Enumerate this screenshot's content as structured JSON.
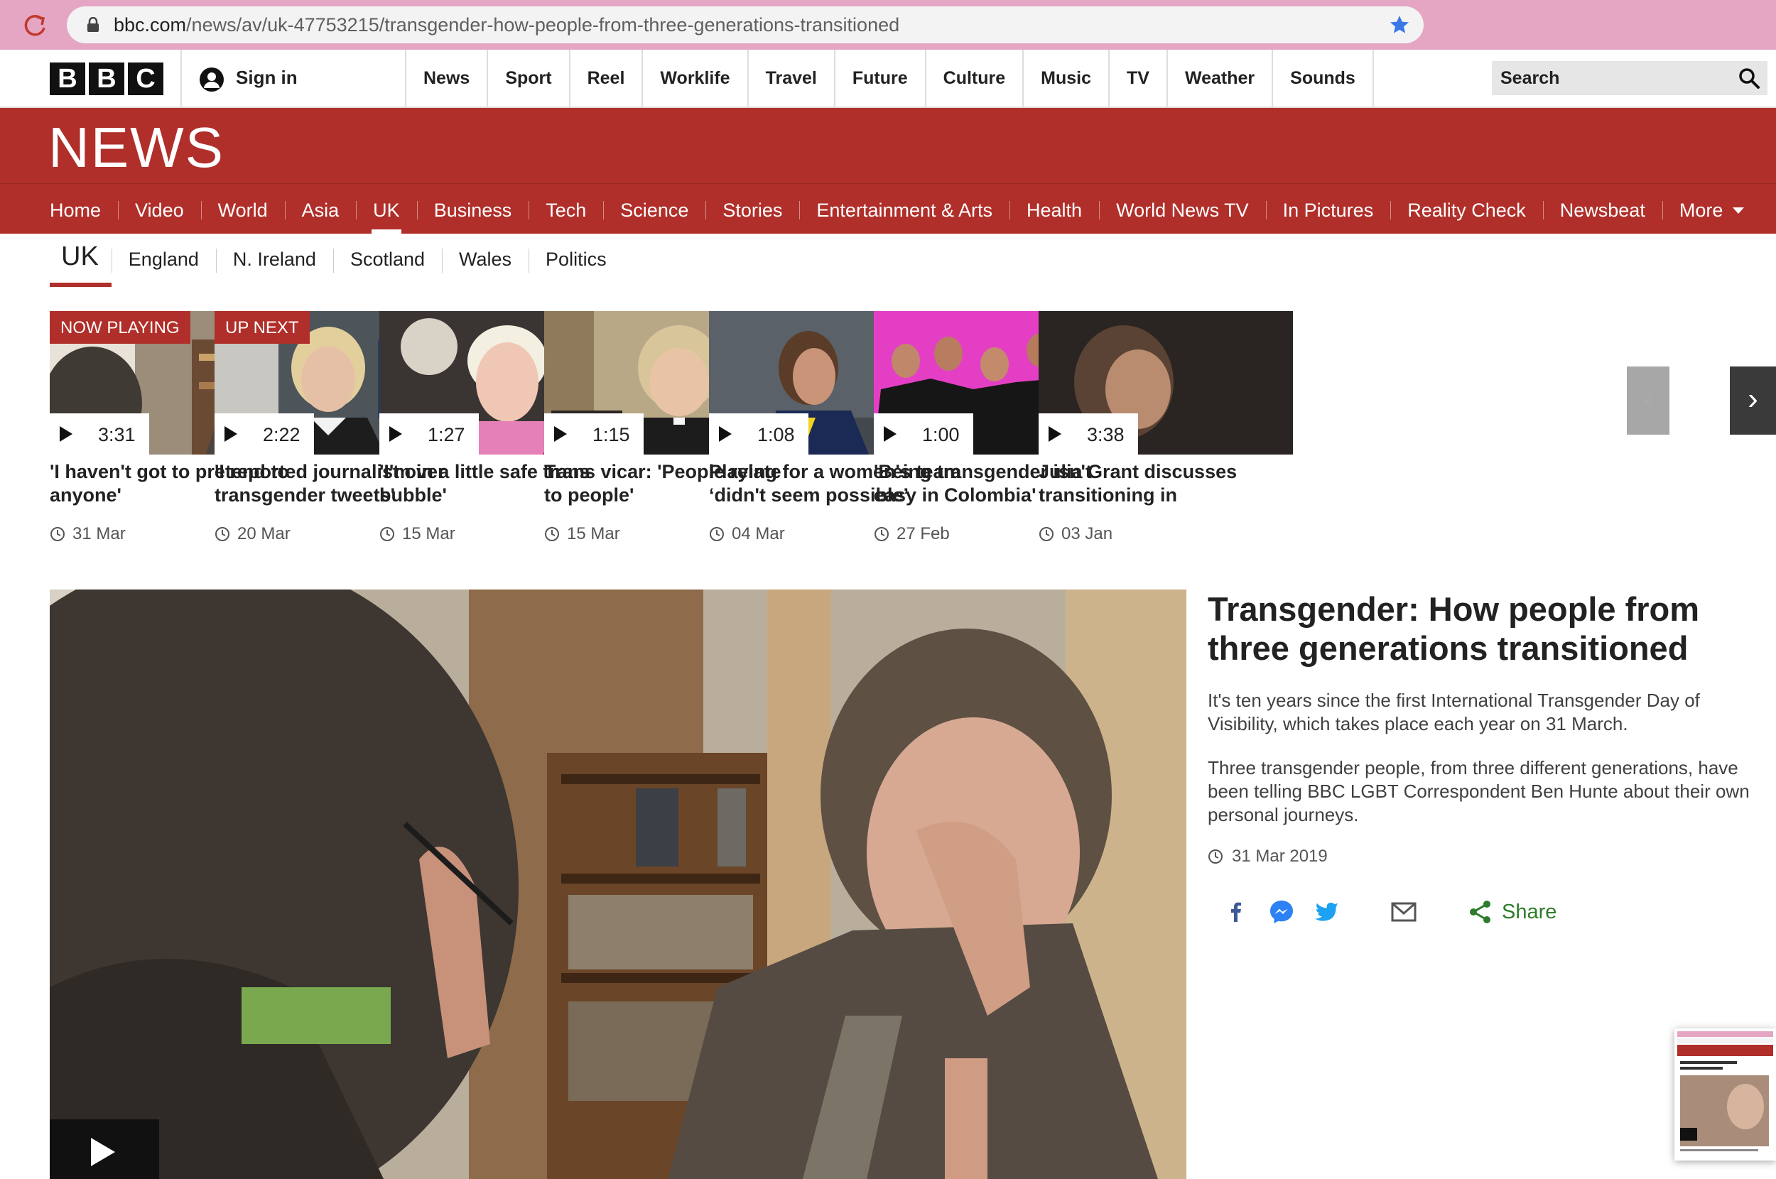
{
  "browser": {
    "url_host": "bbc.com",
    "url_path": "/news/av/uk-47753215/transgender-how-people-from-three-generations-transitioned"
  },
  "topbar": {
    "logo_letters": [
      "B",
      "B",
      "C"
    ],
    "signin_label": "Sign in",
    "nav": [
      "News",
      "Sport",
      "Reel",
      "Worklife",
      "Travel",
      "Future",
      "Culture",
      "Music",
      "TV",
      "Weather",
      "Sounds"
    ],
    "search_placeholder": "Search"
  },
  "banner": {
    "title": "NEWS"
  },
  "mainnav": {
    "items": [
      "Home",
      "Video",
      "World",
      "Asia",
      "UK",
      "Business",
      "Tech",
      "Science",
      "Stories",
      "Entertainment & Arts",
      "Health",
      "World News TV",
      "In Pictures",
      "Reality Check",
      "Newsbeat"
    ],
    "active": "UK",
    "more_label": "More"
  },
  "subnav": {
    "current": "UK",
    "items": [
      "England",
      "N. Ireland",
      "Scotland",
      "Wales",
      "Politics"
    ]
  },
  "playlist": [
    {
      "badge": "NOW PLAYING",
      "duration": "3:31",
      "title": "'I haven't got to pretend to anyone'",
      "date": "31 Mar"
    },
    {
      "badge": "UP NEXT",
      "duration": "2:22",
      "title": "'I reported journalist over transgender tweets'",
      "date": "20 Mar"
    },
    {
      "badge": "",
      "duration": "1:27",
      "title": "'I'm in a little safe trans bubble'",
      "date": "15 Mar"
    },
    {
      "badge": "",
      "duration": "1:15",
      "title": "Trans vicar: 'People relate to people'",
      "date": "15 Mar"
    },
    {
      "badge": "",
      "duration": "1:08",
      "title": "Playing for a women's team ‘didn't seem possible’",
      "date": "04 Mar"
    },
    {
      "badge": "",
      "duration": "1:00",
      "title": "'Being transgender isn't easy in Colombia'",
      "date": "27 Feb"
    },
    {
      "badge": "",
      "duration": "3:38",
      "title": "Julia Grant discusses transitioning in",
      "date": "03 Jan"
    }
  ],
  "carousel": {
    "prev": "‹",
    "next": "›"
  },
  "story": {
    "headline": "Transgender: How people from three generations transitioned",
    "para1": "It's ten years since the first International Transgender Day of Visibility, which takes place each year on 31 March.",
    "para2": "Three transgender people, from three different generations, have been telling BBC LGBT Correspondent Ben Hunte about their own personal journeys.",
    "date": "31 Mar 2019",
    "share_label": "Share",
    "share_icons": [
      "facebook-icon",
      "messenger-icon",
      "twitter-icon",
      "email-icon",
      "share-icon"
    ]
  },
  "colors": {
    "bbc_red": "#b02f2a",
    "share_green": "#2d7c2a",
    "chrome_pink": "#e5a6c3"
  }
}
